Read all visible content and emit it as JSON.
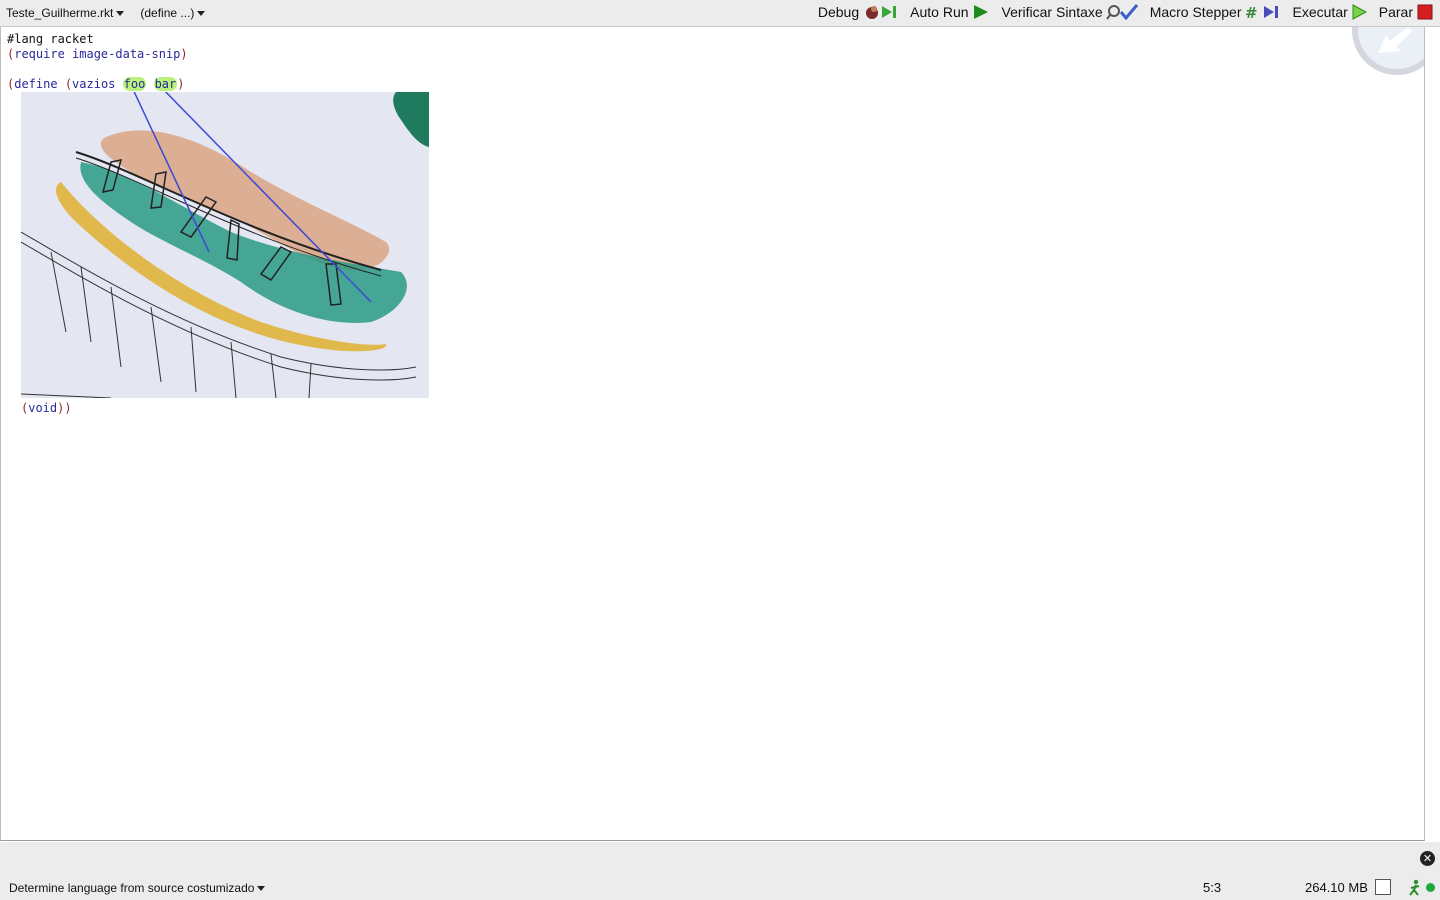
{
  "toolbar": {
    "file_name": "Teste_Guilherme.rkt",
    "define_menu": "(define ...)",
    "debug_label": "Debug",
    "autorun_label": "Auto Run",
    "check_syntax_label": "Verificar Sintaxe",
    "macro_stepper_label": "Macro Stepper",
    "run_label": "Executar",
    "stop_label": "Parar"
  },
  "editor": {
    "line1": "#lang racket",
    "line2_open": "(",
    "line2_kw": "require image-data-snip",
    "line2_close": ")",
    "define_open": "(",
    "define_kw": "define",
    "define_sig_open": " (",
    "define_name": "vazios",
    "arg1": "foo",
    "arg2": "bar",
    "define_sig_close": ")",
    "void_open": "(",
    "void_kw": "void",
    "void_close": "))"
  },
  "status": {
    "language": "Determine language from source costumizado",
    "position": "5:3",
    "memory": "264.10 MB"
  }
}
